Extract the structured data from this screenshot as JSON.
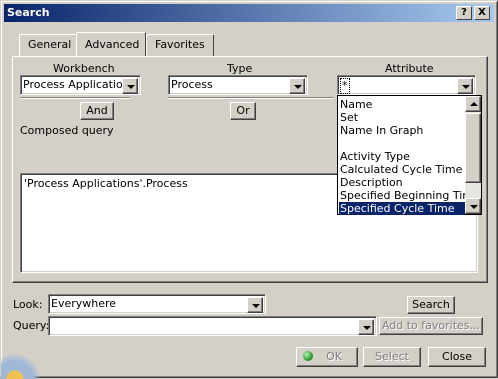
{
  "window": {
    "title": "Search",
    "help_label": "?",
    "close_label": "X"
  },
  "tabs": [
    {
      "label": "General"
    },
    {
      "label": "Advanced"
    },
    {
      "label": "Favorites"
    }
  ],
  "advanced": {
    "workbench_label": "Workbench",
    "type_label": "Type",
    "attribute_label": "Attribute",
    "workbench_value": "Process Applications",
    "type_value": "Process",
    "attribute_value": "*",
    "and_label": "And",
    "or_label": "Or",
    "composed_query_label": "Composed query",
    "composed_query_text": "'Process Applications'.Process"
  },
  "attribute_dropdown": {
    "items": [
      "Name",
      "Set",
      "Name In Graph",
      "",
      "Activity Type",
      "Calculated Cycle Time",
      "Description",
      "Specified Beginning Time",
      "Specified Cycle Time"
    ],
    "selected": "Specified Cycle Time"
  },
  "look": {
    "label": "Look:",
    "value": "Everywhere"
  },
  "query": {
    "label": "Query:",
    "value": ""
  },
  "buttons": {
    "search": "Search",
    "add_to_favorites": "Add to favorites...",
    "ok": "OK",
    "select": "Select",
    "close": "Close"
  },
  "colors": {
    "titlebar_start": "#0a246a",
    "titlebar_end": "#a6caf0",
    "selection": "#0a246a",
    "dialog_bg": "#d4d0c8"
  }
}
